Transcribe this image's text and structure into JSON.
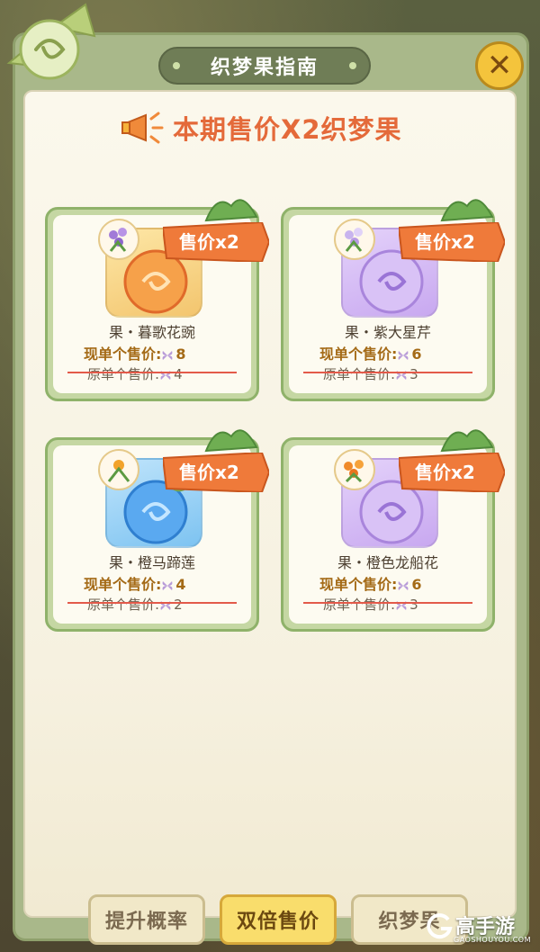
{
  "header": {
    "title": "织梦果指南"
  },
  "headline": {
    "text": "本期售价X2织梦果"
  },
  "cards": [
    {
      "tag": "售价x2",
      "name": "果・暮歌花豌",
      "now_label": "现单个售价:",
      "now_value": "8",
      "old_label": "原单个售价:",
      "old_value": "4",
      "fruit_color": "#f6a14a"
    },
    {
      "tag": "售价x2",
      "name": "果・紫大星芹",
      "now_label": "现单个售价:",
      "now_value": "6",
      "old_label": "原单个售价:",
      "old_value": "3",
      "fruit_color": "#c09be8"
    },
    {
      "tag": "售价x2",
      "name": "果・橙马蹄莲",
      "now_label": "现单个售价:",
      "now_value": "4",
      "old_label": "原单个售价:",
      "old_value": "2",
      "fruit_color": "#5aa9f0"
    },
    {
      "tag": "售价x2",
      "name": "果・橙色龙船花",
      "now_label": "现单个售价:",
      "now_value": "6",
      "old_label": "原单个售价:",
      "old_value": "3",
      "fruit_color": "#c09be8"
    }
  ],
  "tabs": [
    {
      "label": "提升概率"
    },
    {
      "label": "双倍售价"
    },
    {
      "label": "织梦果"
    }
  ],
  "watermark": {
    "main": "高手游",
    "sub": "GAOSHOUYOU.COM"
  }
}
